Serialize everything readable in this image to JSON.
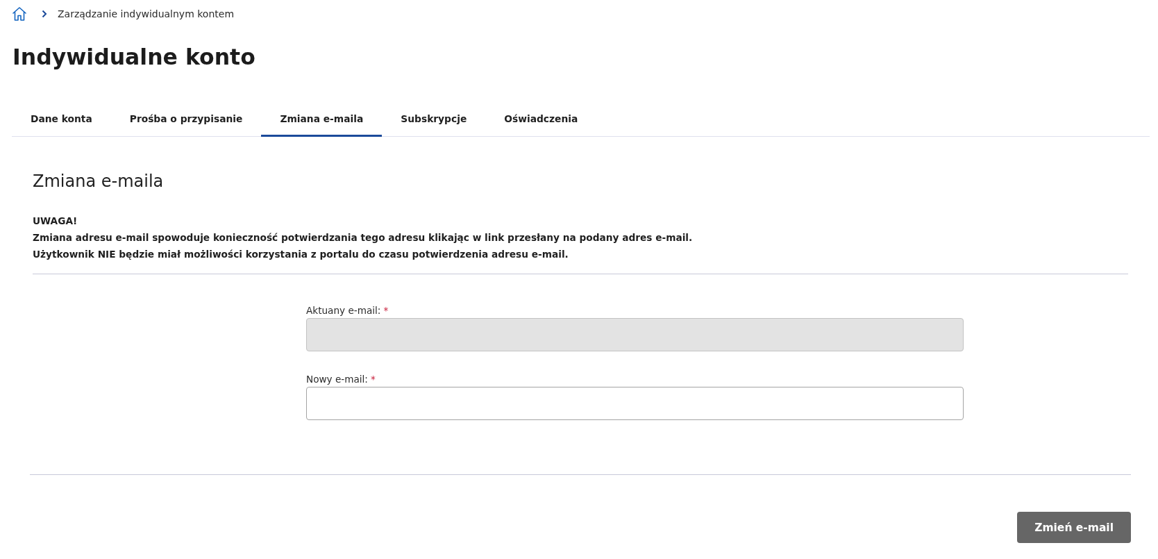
{
  "breadcrumb": {
    "items": [
      "Zarządzanie indywidualnym kontem"
    ]
  },
  "page_title": "Indywidualne konto",
  "tabs": [
    {
      "label": "Dane konta",
      "selected": false
    },
    {
      "label": "Prośba o przypisanie",
      "selected": false
    },
    {
      "label": "Zmiana e-maila",
      "selected": true
    },
    {
      "label": "Subskrypcje",
      "selected": false
    },
    {
      "label": "Oświadczenia",
      "selected": false
    }
  ],
  "section": {
    "title": "Zmiana e-maila",
    "notice": {
      "heading": "UWAGA!",
      "lines": [
        "Zmiana adresu e-mail spowoduje konieczność potwierdzania tego adresu klikając w link przesłany na podany adres e-mail.",
        "Użytkownik NIE będzie miał możliwości korzystania z portalu do czasu potwierdzenia adresu e-mail."
      ]
    }
  },
  "form": {
    "fields": [
      {
        "label": "Aktuany e-mail:",
        "required_mark": "*",
        "disabled": true
      },
      {
        "label": "Nowy e-mail:",
        "required_mark": "*",
        "disabled": false
      }
    ]
  },
  "submit_button": {
    "label": "Zmień e-mail"
  }
}
